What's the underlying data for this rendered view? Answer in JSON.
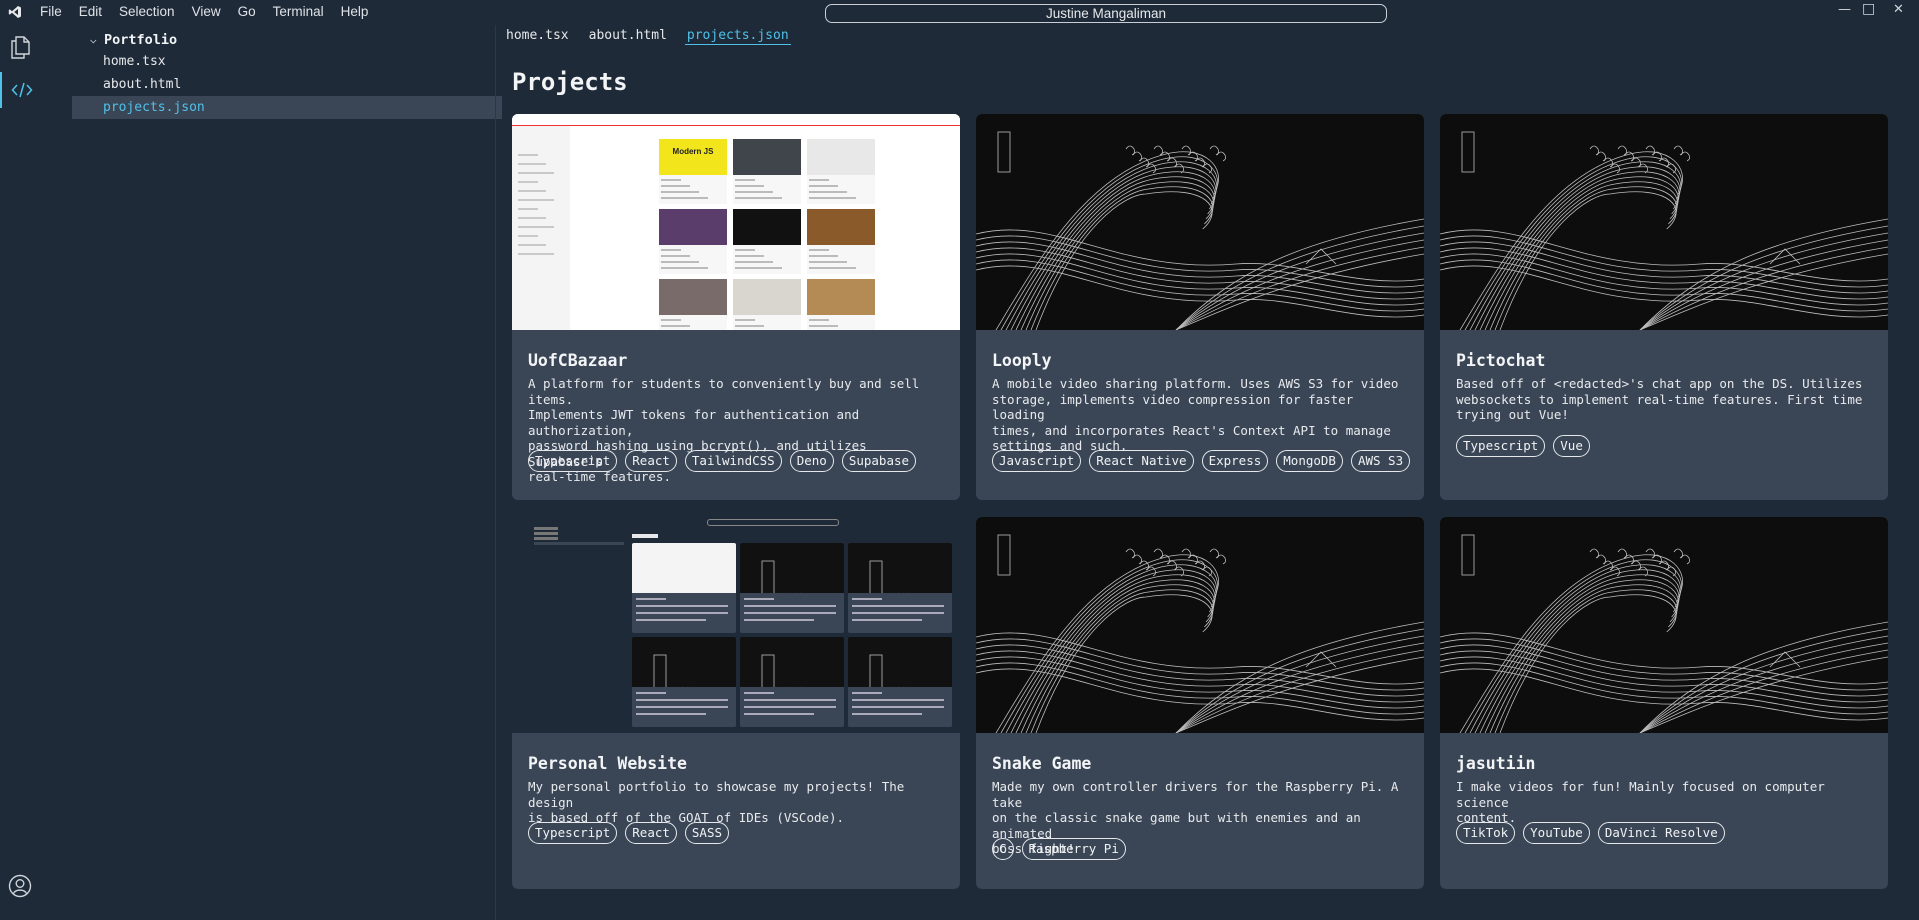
{
  "window": {
    "search_text": "Justine Mangaliman",
    "menu": [
      "File",
      "Edit",
      "Selection",
      "View",
      "Go",
      "Terminal",
      "Help"
    ],
    "controls": {
      "minimize": "—",
      "maximize": "□",
      "close": "✕"
    }
  },
  "sidebar": {
    "folder": "Portfolio",
    "files": [
      "home.tsx",
      "about.html",
      "projects.json"
    ],
    "active_file": "projects.json"
  },
  "tabs": [
    "home.tsx",
    "about.html",
    "projects.json"
  ],
  "page": {
    "title": "Projects"
  },
  "projects": [
    {
      "title": "UofCBazaar",
      "description": "A platform for students to conveniently buy and sell items.\nImplements JWT tokens for authentication and authorization,\npassword hashing using bcrypt(), and utilizes Supabase's\nreal-time features.",
      "tags": [
        "Typescript",
        "React",
        "TailwindCSS",
        "Deno",
        "Supabase"
      ],
      "thumb": "bazaar"
    },
    {
      "title": "Looply",
      "description": "A mobile video sharing platform. Uses AWS S3 for video\nstorage, implements video compression for faster loading\ntimes, and incorporates React's Context API to manage\nsettings and such.",
      "tags": [
        "Javascript",
        "React Native",
        "Express",
        "MongoDB",
        "AWS S3"
      ],
      "thumb": "wave"
    },
    {
      "title": "Pictochat",
      "description": "Based off of <redacted>'s chat app on the DS. Utilizes\nwebsockets to implement real-time features. First time\ntrying out Vue!",
      "tags": [
        "Typescript",
        "Vue"
      ],
      "thumb": "wave"
    },
    {
      "title": "Personal Website",
      "description": "My personal portfolio to showcase my projects! The design\nis based off of the GOAT of IDEs (VSCode).",
      "tags": [
        "Typescript",
        "React",
        "SASS"
      ],
      "thumb": "mini"
    },
    {
      "title": "Snake Game",
      "description": "Made my own controller drivers for the Raspberry Pi. A take\non the classic snake game but with enemies and an animated\nboss fight!",
      "tags": [
        "C",
        "Raspberry Pi"
      ],
      "thumb": "wave"
    },
    {
      "title": "jasutiin",
      "description": "I make videos for fun! Mainly focused on computer science\ncontent.",
      "tags": [
        "TikTok",
        "YouTube",
        "DaVinci Resolve"
      ],
      "thumb": "wave"
    }
  ],
  "bazaar_thumb": {
    "brand": "UofCBazaar",
    "tile_label": "Modern JS"
  },
  "icons": {
    "app_logo": "vscode-logo-icon",
    "explorer": "files-icon",
    "code": "code-icon",
    "account": "account-icon"
  },
  "colors": {
    "accent": "#4fc1e9",
    "background": "#1e2a38",
    "card": "#3a4656"
  }
}
